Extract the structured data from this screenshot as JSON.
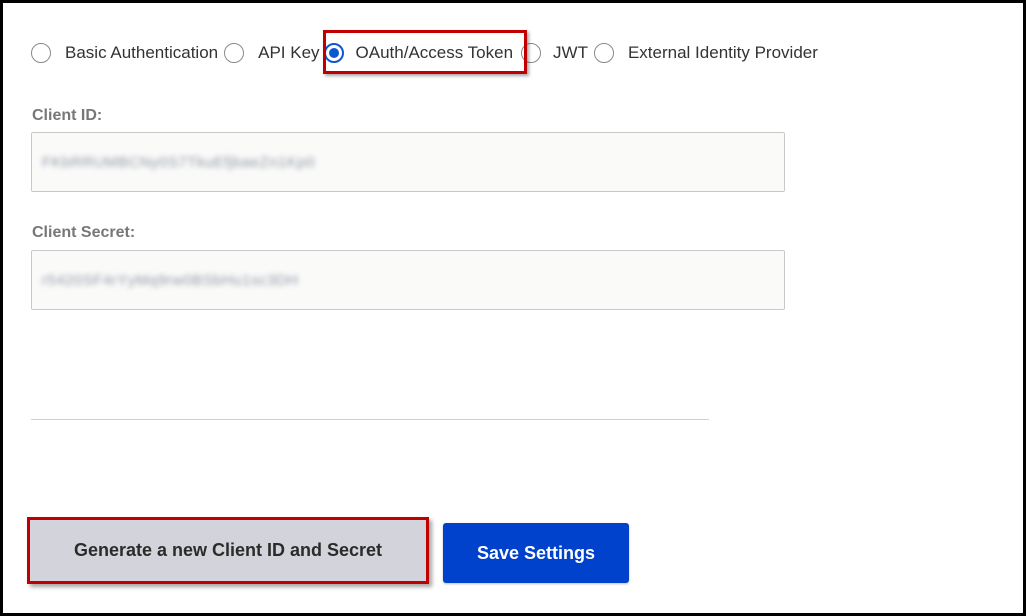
{
  "auth_options": [
    {
      "label": "Basic Authentication",
      "checked": false
    },
    {
      "label": "API Key",
      "checked": false
    },
    {
      "label": "OAuth/Access Token",
      "checked": true
    },
    {
      "label": "JWT",
      "checked": false
    },
    {
      "label": "External Identity Provider",
      "checked": false
    }
  ],
  "client_id": {
    "label": "Client ID:",
    "value": "FKbRRUMBCNy0S7TkuEfjbaeZn1Kp0"
  },
  "client_secret": {
    "label": "Client Secret:",
    "value": "r5420SF4rYyMq9rw0BSbHu1sc3DH"
  },
  "buttons": {
    "generate_label": "Generate a new Client ID and Secret",
    "save_label": "Save Settings"
  },
  "colors": {
    "accent": "#0042cc",
    "radio_selected": "#0b57d0",
    "highlight": "#c00000",
    "secondary_button": "#d3d4db"
  }
}
